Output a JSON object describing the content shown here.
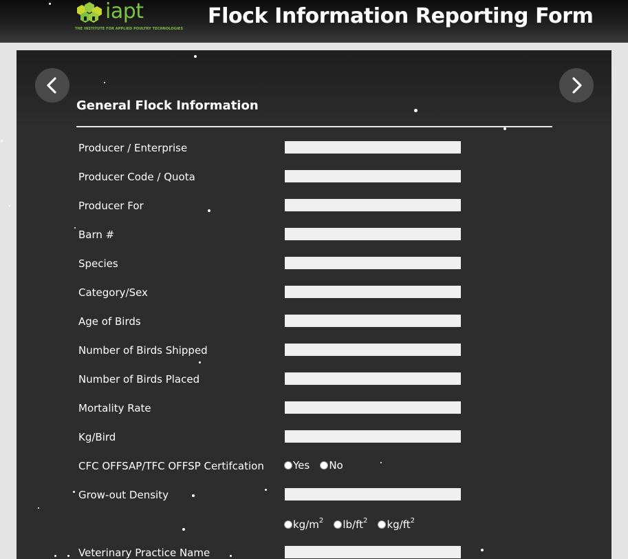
{
  "header": {
    "logo_word": "iapt",
    "logo_subtitle": "THE INSTITUTE FOR APPLIED POULTRY TECHNOLOGIES",
    "title": "Flock Information Reporting Form"
  },
  "nav": {
    "prev_icon": "chevron-left-icon",
    "next_icon": "chevron-right-icon"
  },
  "section": {
    "title": "General Flock Information"
  },
  "fields": [
    {
      "label": "Producer / Enterprise",
      "value": ""
    },
    {
      "label": "Producer Code / Quota",
      "value": ""
    },
    {
      "label": "Producer For",
      "value": ""
    },
    {
      "label": "Barn #",
      "value": ""
    },
    {
      "label": "Species",
      "value": ""
    },
    {
      "label": "Category/Sex",
      "value": ""
    },
    {
      "label": "Age of Birds",
      "value": ""
    },
    {
      "label": "Number of Birds Shipped",
      "value": ""
    },
    {
      "label": "Number of Birds Placed",
      "value": ""
    },
    {
      "label": "Mortality Rate",
      "value": ""
    },
    {
      "label": "Kg/Bird",
      "value": ""
    }
  ],
  "certification": {
    "label": "CFC OFFSAP/TFC OFFSP Certifcation",
    "options": [
      "Yes",
      "No"
    ]
  },
  "density": {
    "label": "Grow-out Density",
    "value": "",
    "units": [
      "kg/m",
      "lb/ft",
      "kg/ft"
    ],
    "unit_exponent": "2"
  },
  "vet": {
    "label": "Veterinary Practice Name",
    "value": ""
  },
  "colors": {
    "accent": "#7dc242",
    "panel": "#2d2d2d",
    "input": "#efefef"
  }
}
